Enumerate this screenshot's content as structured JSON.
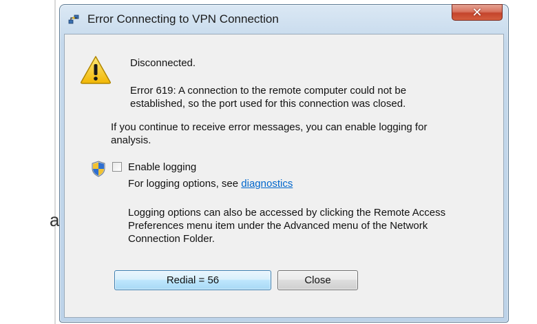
{
  "window": {
    "title": "Error Connecting to VPN Connection",
    "close_glyph": "✕"
  },
  "message": {
    "status": "Disconnected.",
    "error_line1": "Error 619: A connection to the remote computer could not be",
    "error_line2": "established, so the port used for this connection was closed.",
    "continue_line1": "If you continue to receive error messages, you can enable logging for",
    "continue_line2": "analysis."
  },
  "logging": {
    "checkbox_label": "Enable logging",
    "checked": false,
    "options_prefix": "For logging options, see ",
    "diagnostics_link": "diagnostics",
    "info_line1": "Logging options can also be accessed by clicking the Remote Access",
    "info_line2": "Preferences menu item under the Advanced menu of the Network",
    "info_line3": "Connection Folder."
  },
  "buttons": {
    "redial_label": "Redial = 56",
    "close_label": "Close"
  },
  "background": {
    "fragment_letter": "a"
  },
  "colors": {
    "link": "#0066cc",
    "close_button": "#c4442c",
    "default_button_border": "#3c7fb1"
  },
  "icons": {
    "title": "vpn-network-icon",
    "warning": "warning-icon",
    "shield": "uac-shield-icon",
    "close": "close-icon"
  }
}
